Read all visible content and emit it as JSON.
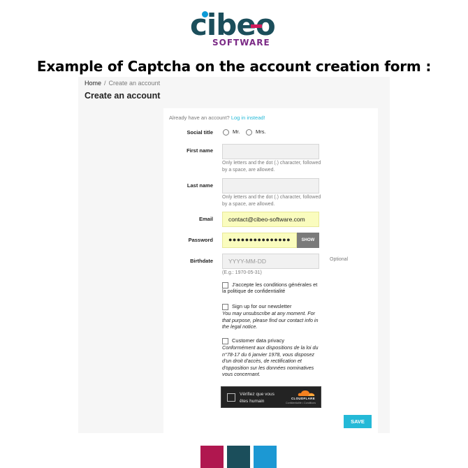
{
  "logo": {
    "word": "cibeo",
    "sub": "SOFTWARE"
  },
  "headline": "Example of Captcha on the account creation form :",
  "breadcrumb": {
    "home": "Home",
    "separator": "/",
    "current": "Create an account"
  },
  "page_title": "Create an account",
  "form": {
    "already_text": "Already have an account?",
    "login_link": "Log in instead!",
    "social_title": {
      "label": "Social title",
      "options": [
        "Mr.",
        "Mrs."
      ]
    },
    "first_name": {
      "label": "First name",
      "value": "",
      "help": "Only letters and the dot (.) character, followed by a space, are allowed."
    },
    "last_name": {
      "label": "Last name",
      "value": "",
      "help": "Only letters and the dot (.) character, followed by a space, are allowed."
    },
    "email": {
      "label": "Email",
      "value": "contact@cibeo-software.com"
    },
    "password": {
      "label": "Password",
      "value": "●●●●●●●●●●●●●●●",
      "show_label": "SHOW"
    },
    "birthdate": {
      "label": "Birthdate",
      "placeholder": "YYYY-MM-DD",
      "help": "(E.g.: 1970-05-31)",
      "optional": "Optional"
    },
    "terms": {
      "label": "J'accepte les conditions générales et",
      "label2": "la politique de confidentialité"
    },
    "newsletter": {
      "label": "Sign up for our newsletter",
      "note": "You may unsubscribe at any moment. For that purpose, please find our contact info in the legal notice."
    },
    "privacy": {
      "label": "Customer data privacy",
      "note": "Conformément aux dispositions de la loi du n°78-17 du 6 janvier 1978, vous disposez d'un droit d'accès, de rectification et d'opposition sur les données nominatives vous concernant."
    },
    "save_label": "SAVE"
  },
  "captcha": {
    "text_line1": "Vérifiez que vous",
    "text_line2": "êtes humain",
    "brand": "CLOUDFLARE",
    "links": "Confidentialité • Conditions"
  },
  "colors": {
    "accent": "#24b9d7",
    "swatch1": "#b0174f",
    "swatch2": "#1b4e5b",
    "swatch3": "#1c98d3"
  }
}
